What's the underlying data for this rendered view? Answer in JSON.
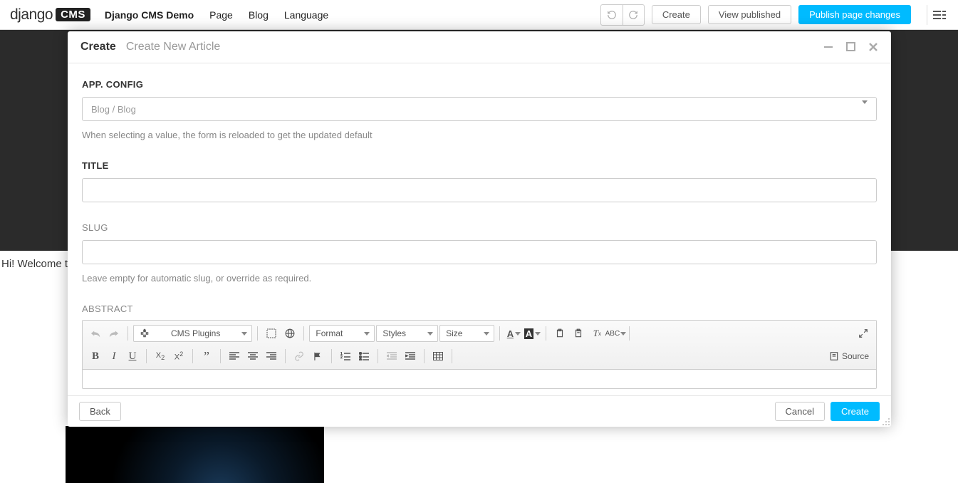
{
  "topbar": {
    "logo_left": "django",
    "logo_right": "CMS",
    "menu": [
      "Django CMS Demo",
      "Page",
      "Blog",
      "Language"
    ],
    "create": "Create",
    "view_published": "View published",
    "publish": "Publish page changes"
  },
  "page": {
    "welcome": "Hi! Welcome to"
  },
  "modal": {
    "breadcrumb1": "Create",
    "breadcrumb2": "Create New Article",
    "footer": {
      "back": "Back",
      "cancel": "Cancel",
      "create": "Create"
    }
  },
  "form": {
    "app_config": {
      "label": "App. Config",
      "value": "Blog / Blog",
      "help": "When selecting a value, the form is reloaded to get the updated default"
    },
    "title": {
      "label": "Title"
    },
    "slug": {
      "label": "Slug",
      "help": "Leave empty for automatic slug, or override as required."
    },
    "abstract": {
      "label": "Abstract"
    }
  },
  "editor": {
    "cms_plugins": "CMS Plugins",
    "format": "Format",
    "styles": "Styles",
    "size": "Size",
    "source": "Source"
  }
}
